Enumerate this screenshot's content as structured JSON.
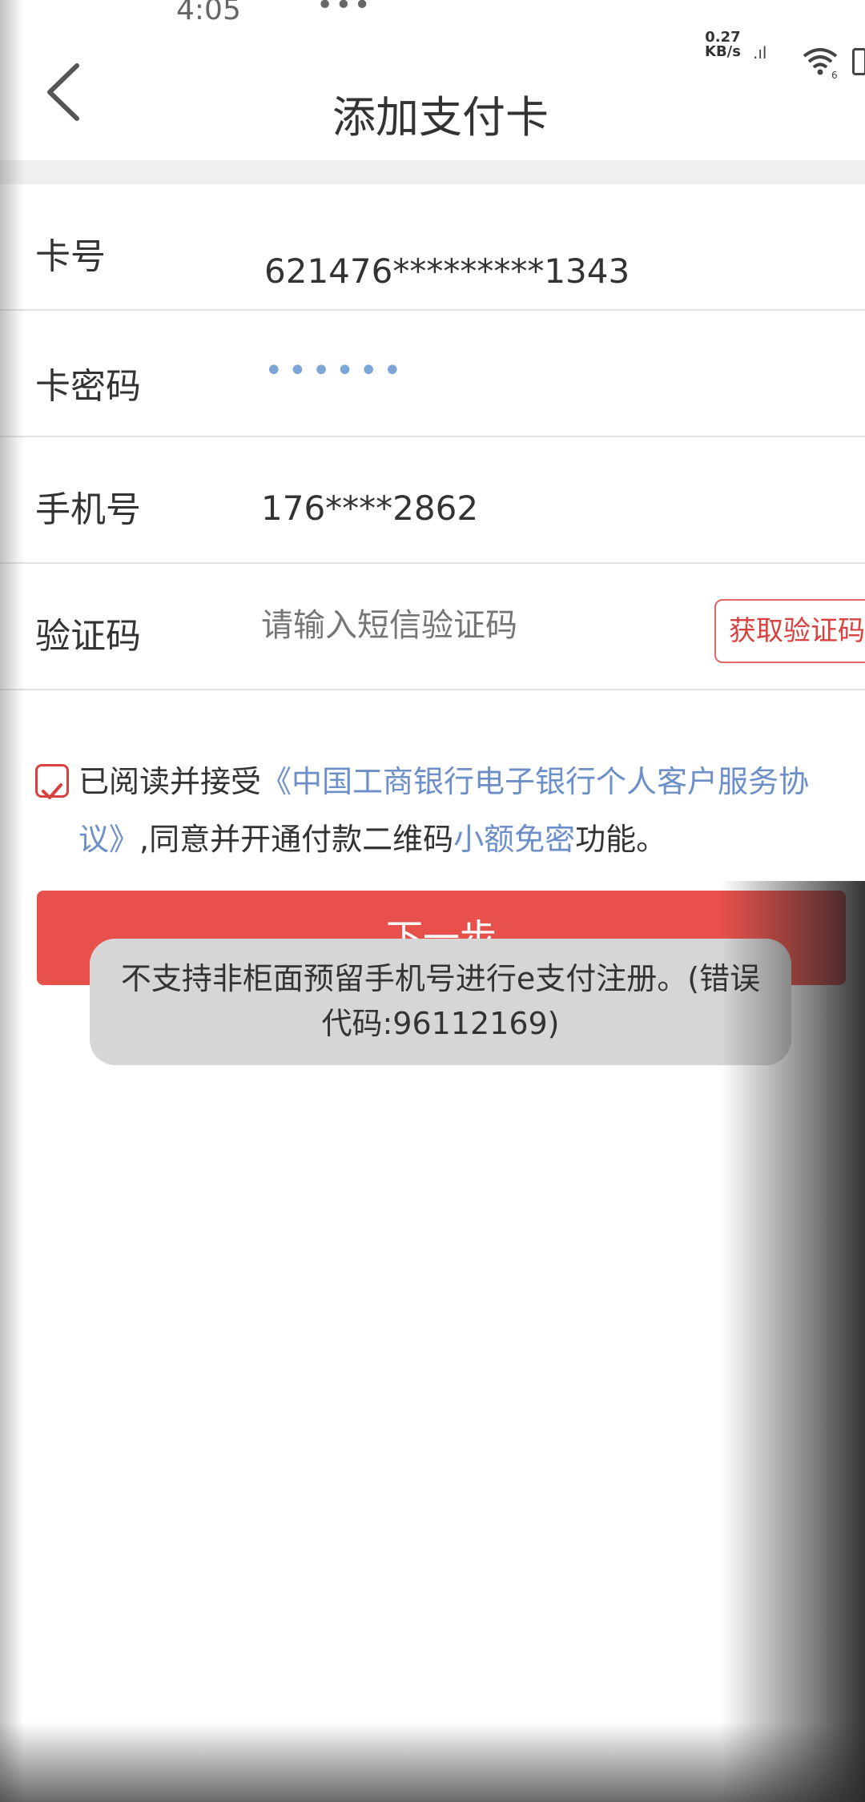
{
  "status_bar": {
    "time": "4:05",
    "dots": "•••",
    "net_speed_value": "0.27",
    "net_speed_unit": "KB/s",
    "signal_text": ".ıl",
    "wifi_badge": "6"
  },
  "header": {
    "title": "添加支付卡",
    "back_icon": "chevron-left-icon"
  },
  "form": {
    "card_number": {
      "label": "卡号",
      "value": "621476*********1343"
    },
    "card_password": {
      "label": "卡密码",
      "value": "••••••"
    },
    "phone": {
      "label": "手机号",
      "value": "176****2862"
    },
    "verification": {
      "label": "验证码",
      "placeholder": "请输入短信验证码",
      "button_label": "获取验证码"
    }
  },
  "agreement": {
    "checked": true,
    "prefix": "已阅读并接受",
    "link_text": "《中国工商银行电子银行个人客户服务协议》",
    "middle": ",同意并开通付款二维码",
    "small_link": "小额免密",
    "suffix": "功能。"
  },
  "next_button": {
    "label": "下一步"
  },
  "toast": {
    "message": "不支持非柜面预留手机号进行e支付注册。(错误代码:96112169)"
  },
  "colors": {
    "accent_red": "#e8514b",
    "link_blue": "#6c8fc9",
    "toast_bg": "#d6d6d6"
  }
}
